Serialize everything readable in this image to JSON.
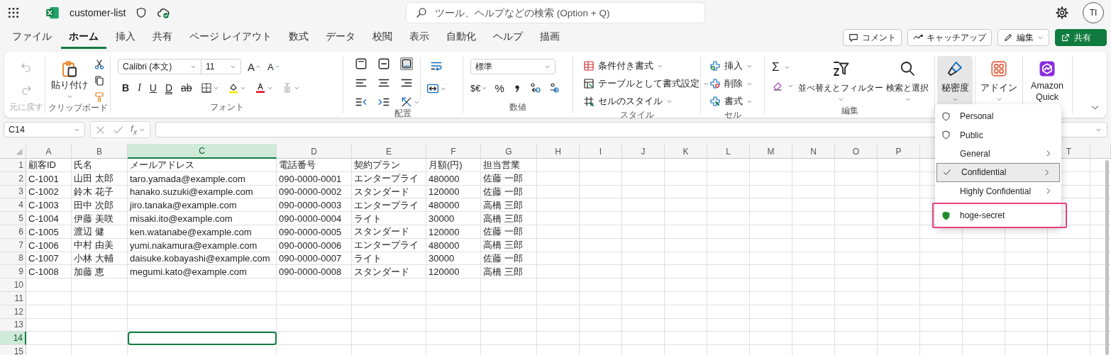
{
  "title_bar": {
    "file_name": "customer-list",
    "search": {
      "placeholder": "ツール、ヘルプなどの検索 (Option + Q)"
    },
    "avatar": "TI"
  },
  "menu_tabs": [
    {
      "label": "ファイル",
      "selected": false
    },
    {
      "label": "ホーム",
      "selected": true
    },
    {
      "label": "挿入",
      "selected": false
    },
    {
      "label": "共有",
      "selected": false
    },
    {
      "label": "ページ レイアウト",
      "selected": false
    },
    {
      "label": "数式",
      "selected": false
    },
    {
      "label": "データ",
      "selected": false
    },
    {
      "label": "校閲",
      "selected": false
    },
    {
      "label": "表示",
      "selected": false
    },
    {
      "label": "自動化",
      "selected": false
    },
    {
      "label": "ヘルプ",
      "selected": false
    },
    {
      "label": "描画",
      "selected": false
    }
  ],
  "actions": [
    {
      "label": "コメント",
      "kind": "comment"
    },
    {
      "label": "キャッチアップ",
      "kind": "catchup"
    },
    {
      "label": "編集",
      "kind": "edit"
    },
    {
      "label": "共有",
      "kind": "share"
    }
  ],
  "ribbon": {
    "undo_group": {
      "label": "元に戻す",
      "disabled": true
    },
    "clipboard_group": {
      "label": "クリップボード",
      "paste": "貼り付け"
    },
    "font_group": {
      "label": "フォント",
      "font_name": "Calibri (本文)",
      "font_size": "11",
      "grow": "A",
      "shrink": "A",
      "bold": "B",
      "italic": "I",
      "underline": "U",
      "double_underline": "D",
      "strikethrough": "ab"
    },
    "alignment_group": {
      "label": "配置"
    },
    "number_group": {
      "label": "数値",
      "format": "標準",
      "currency": "$€",
      "percent": "%"
    },
    "styles_group": {
      "label": "スタイル",
      "items": [
        {
          "label": "条件付き書式",
          "kind": "conditional"
        },
        {
          "label": "テーブルとして書式設定",
          "kind": "table"
        },
        {
          "label": "セルのスタイル",
          "kind": "cellstyle"
        }
      ]
    },
    "cells_group": {
      "label": "セル",
      "items": [
        {
          "label": "挿入",
          "kind": "insert"
        },
        {
          "label": "削除",
          "kind": "delete"
        },
        {
          "label": "書式",
          "kind": "format"
        }
      ]
    },
    "editing_group": {
      "label": "編集",
      "sum": "Σ",
      "sort": "並べ替えとフィルター",
      "find": "検索と選択"
    },
    "sensitivity": {
      "label": "秘密度",
      "expanded": true
    },
    "addins": {
      "label": "アドイン"
    },
    "amazon_quick": {
      "label": "Amazon Quick"
    }
  },
  "formula_bar": {
    "name_box": "C14",
    "fx": "f$_{x}$"
  },
  "grid": {
    "columns": [
      {
        "label": "A",
        "selected": false
      },
      {
        "label": "B",
        "selected": false
      },
      {
        "label": "C",
        "selected": true
      },
      {
        "label": "D",
        "selected": false
      },
      {
        "label": "E",
        "selected": false
      },
      {
        "label": "F",
        "selected": false
      },
      {
        "label": "G",
        "selected": false
      },
      {
        "label": "H",
        "selected": false
      },
      {
        "label": "I",
        "selected": false
      },
      {
        "label": "J",
        "selected": false
      },
      {
        "label": "K",
        "selected": false
      },
      {
        "label": "L",
        "selected": false
      },
      {
        "label": "M",
        "selected": false
      },
      {
        "label": "N",
        "selected": false
      },
      {
        "label": "O",
        "selected": false
      },
      {
        "label": "P",
        "selected": false
      }
    ],
    "columns_right": [
      {
        "label": "T",
        "selected": false
      }
    ],
    "rows": [
      {
        "number": "1",
        "selected": false,
        "cells": [
          "顧客ID",
          "氏名",
          "メールアドレス",
          "電話番号",
          "契約プラン",
          "月額(円)",
          "担当営業"
        ]
      },
      {
        "number": "2",
        "selected": false,
        "cells": [
          "C-1001",
          "山田 太郎",
          "taro.yamada@example.com",
          "090-0000-0001",
          "エンタープライ",
          "480000",
          "佐藤 一郎"
        ]
      },
      {
        "number": "3",
        "selected": false,
        "cells": [
          "C-1002",
          "鈴木 花子",
          "hanako.suzuki@example.com",
          "090-0000-0002",
          "スタンダード",
          "120000",
          "佐藤 一郎"
        ]
      },
      {
        "number": "4",
        "selected": false,
        "cells": [
          "C-1003",
          "田中 次郎",
          "jiro.tanaka@example.com",
          "090-0000-0003",
          "エンタープライ",
          "480000",
          "高橋 三郎"
        ]
      },
      {
        "number": "5",
        "selected": false,
        "cells": [
          "C-1004",
          "伊藤 美咲",
          "misaki.ito@example.com",
          "090-0000-0004",
          "ライト",
          "30000",
          "高橋 三郎"
        ]
      },
      {
        "number": "6",
        "selected": false,
        "cells": [
          "C-1005",
          "渡辺 健",
          "ken.watanabe@example.com",
          "090-0000-0005",
          "スタンダード",
          "120000",
          "佐藤 一郎"
        ]
      },
      {
        "number": "7",
        "selected": false,
        "cells": [
          "C-1006",
          "中村 由美",
          "yumi.nakamura@example.com",
          "090-0000-0006",
          "エンタープライ",
          "480000",
          "高橋 三郎"
        ]
      },
      {
        "number": "8",
        "selected": false,
        "cells": [
          "C-1007",
          "小林 大輔",
          "daisuke.kobayashi@example.com",
          "090-0000-0007",
          "ライト",
          "30000",
          "佐藤 一郎"
        ]
      },
      {
        "number": "9",
        "selected": false,
        "cells": [
          "C-1008",
          "加藤 恵",
          "megumi.kato@example.com",
          "090-0000-0008",
          "スタンダード",
          "120000",
          "高橋 三郎"
        ]
      },
      {
        "number": "10",
        "selected": false
      },
      {
        "number": "11",
        "selected": false
      },
      {
        "number": "12",
        "selected": false
      },
      {
        "number": "13",
        "selected": false
      },
      {
        "number": "14",
        "selected": true
      },
      {
        "number": "15",
        "selected": false
      }
    ]
  },
  "sensitivity_menu": [
    {
      "label": "Personal",
      "kind": "shield",
      "submenu": false,
      "selected": false,
      "highlighted": false
    },
    {
      "label": "Public",
      "kind": "shield",
      "submenu": false,
      "selected": false,
      "highlighted": false
    },
    {
      "label": "General",
      "kind": "plain",
      "submenu": true,
      "selected": false,
      "highlighted": false
    },
    {
      "label": "Confidential",
      "kind": "plain",
      "submenu": true,
      "selected": true,
      "highlighted": false
    },
    {
      "label": "Highly Confidential",
      "kind": "plain",
      "submenu": true,
      "selected": false,
      "highlighted": false
    },
    {
      "label": "hoge-secret",
      "kind": "colored",
      "color": "#1e8c2a",
      "submenu": false,
      "selected": false,
      "highlighted": true
    }
  ]
}
